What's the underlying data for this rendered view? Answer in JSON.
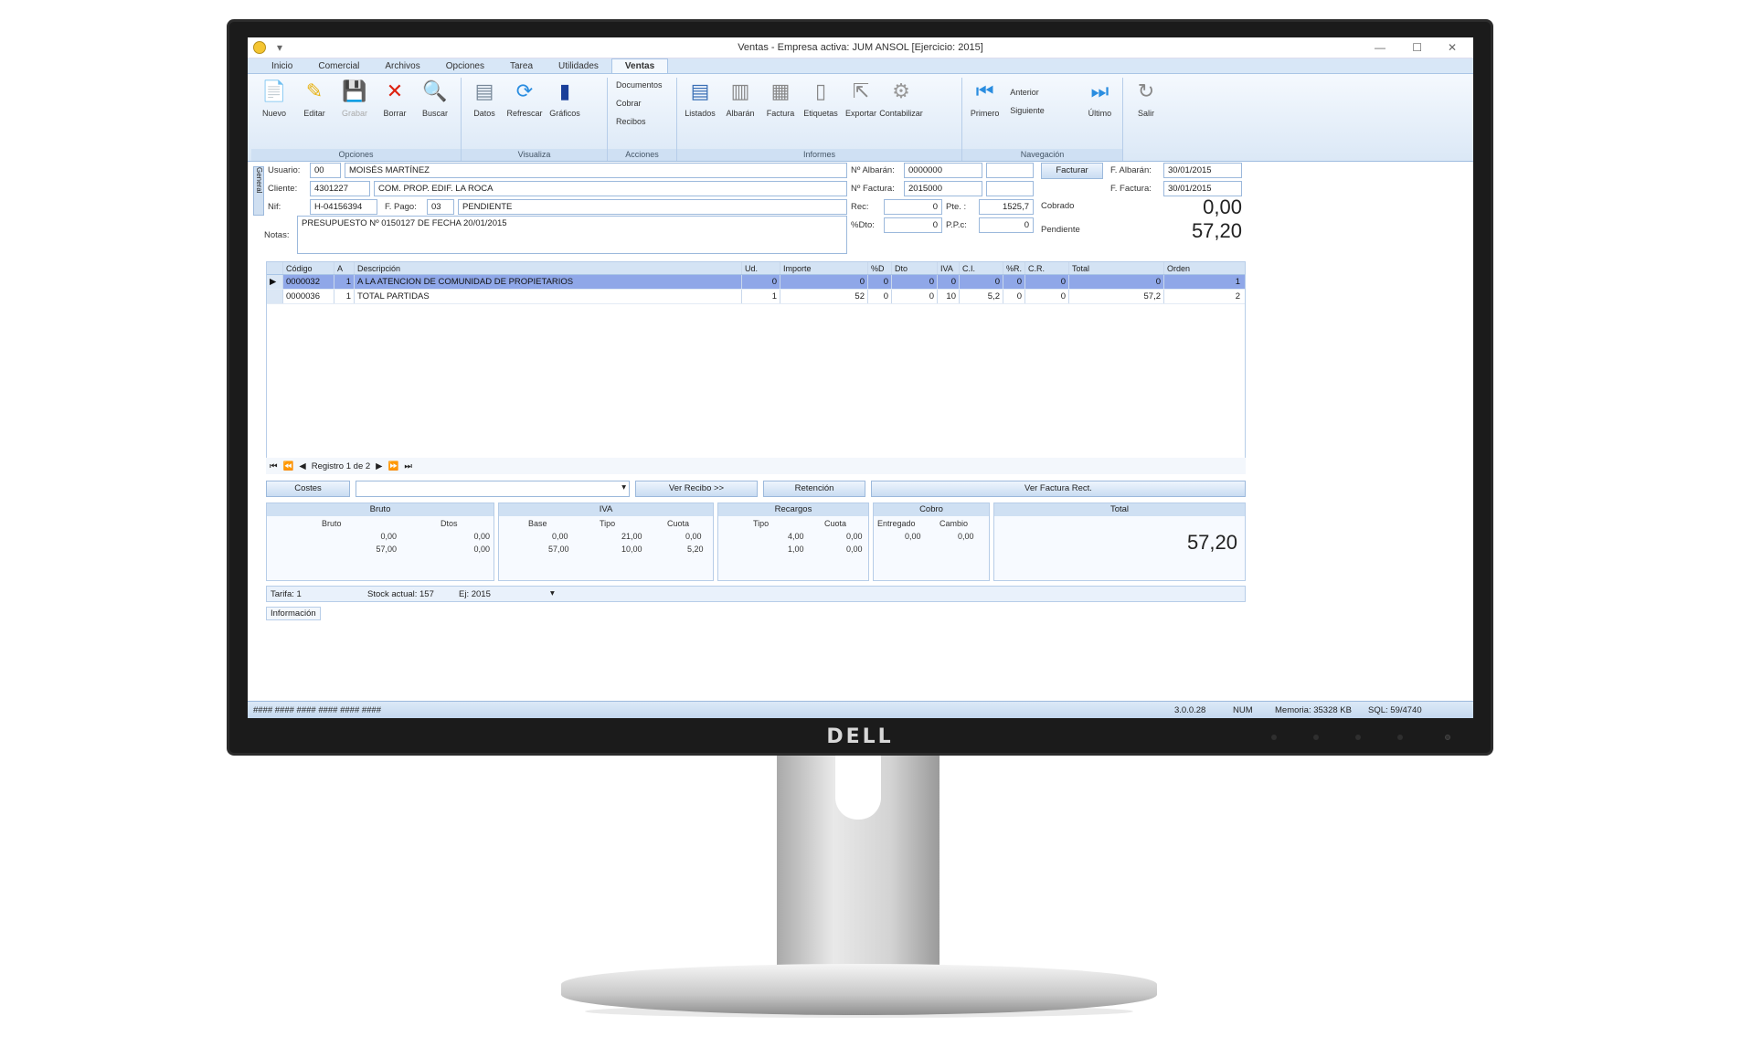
{
  "window": {
    "title": "Ventas - Empresa activa: JUM ANSOL [Ejercicio: 2015]"
  },
  "menu": {
    "tabs": [
      "Inicio",
      "Comercial",
      "Archivos",
      "Opciones",
      "Tarea",
      "Utilidades",
      "Ventas"
    ],
    "active": "Ventas"
  },
  "ribbon": {
    "opciones": {
      "label": "Opciones",
      "buttons": [
        "Nuevo",
        "Editar",
        "Grabar",
        "Borrar",
        "Buscar"
      ]
    },
    "visualiza": {
      "label": "Visualiza",
      "buttons": [
        "Datos",
        "Refrescar",
        "Gráficos"
      ]
    },
    "acciones": {
      "label": "Acciones",
      "buttons": [
        "Documentos",
        "Cobrar",
        "Recibos"
      ]
    },
    "informes": {
      "label": "Informes",
      "buttons": [
        "Listados",
        "Albarán",
        "Factura",
        "Etiquetas",
        "Exportar",
        "Contabilizar"
      ]
    },
    "navegacion": {
      "label": "Navegación",
      "buttons": [
        "Primero",
        "Anterior",
        "Siguiente",
        "Último"
      ]
    },
    "salir": {
      "label": "Salir"
    }
  },
  "form": {
    "side_tab": "General",
    "usuario_label": "Usuario:",
    "usuario_code": "00",
    "usuario_name": "MOISÉS MARTÍNEZ",
    "cliente_label": "Cliente:",
    "cliente_code": "4301227",
    "cliente_name": "COM. PROP. EDIF. LA ROCA",
    "nif_label": "Nif:",
    "nif_value": "H-04156394",
    "fpago_label": "F. Pago:",
    "fpago_code": "03",
    "fpago_name": "PENDIENTE",
    "notas_label": "Notas:",
    "notas_value": "PRESUPUESTO Nº 0150127 DE FECHA 20/01/2015",
    "nalbaran_label": "Nº Albarán:",
    "nalbaran_value": "0000000",
    "nfactura_label": "Nº Factura:",
    "nfactura_value": "2015000",
    "rec_label": "Rec:",
    "rec_value": "0",
    "pte_label": "Pte. :",
    "pte_value": "1525,7",
    "pcdto_label": "%Dto:",
    "pcdto_value": "0",
    "ppc_label": "P.P.c:",
    "ppc_value": "0",
    "factura_button": "Facturar",
    "falbaran_label": "F. Albarán:",
    "falbaran_value": "30/01/2015",
    "ffactura_label": "F. Factura:",
    "ffactura_value": "30/01/2015",
    "cobrado_label": "Cobrado",
    "cobrado_value": "0,00",
    "pendiente_label": "Pendiente",
    "pendiente_value": "57,20"
  },
  "grid": {
    "columns": [
      "Código",
      "A",
      "Descripción",
      "Ud.",
      "Importe",
      "%D",
      "Dto",
      "IVA",
      "C.I.",
      "%R.",
      "C.R.",
      "Total",
      "Orden"
    ],
    "rows": [
      [
        "0000032",
        "1",
        "A LA ATENCION DE COMUNIDAD DE PROPIETARIOS",
        "0",
        "0",
        "0",
        "0",
        "0",
        "0",
        "0",
        "0",
        "0",
        "1"
      ],
      [
        "0000036",
        "1",
        "TOTAL PARTIDAS",
        "1",
        "52",
        "0",
        "0",
        "10",
        "5,2",
        "0",
        "0",
        "57,2",
        "2"
      ]
    ]
  },
  "navbar": {
    "record": "Registro 1 de 2"
  },
  "actions": {
    "costes": "Costes",
    "ver_recibo": "Ver Recibo >>",
    "retencion": "Retención",
    "ver_factura": "Ver Factura Rect."
  },
  "totals": {
    "bruto": {
      "title": "Bruto",
      "col1": "Bruto",
      "col2": "Dtos",
      "r1": [
        "0,00",
        "0,00"
      ],
      "r2": [
        "57,00",
        "0,00"
      ]
    },
    "iva": {
      "title": "IVA",
      "col1": "Base",
      "col2": "Tipo",
      "col3": "Cuota",
      "r1": [
        "0,00",
        "21,00",
        "0,00"
      ],
      "r2": [
        "57,00",
        "10,00",
        "5,20"
      ]
    },
    "recargos": {
      "title": "Recargos",
      "col1": "Tipo",
      "col2": "Cuota",
      "r1": [
        "4,00",
        "0,00"
      ],
      "r2": [
        "1,00",
        "0,00"
      ]
    },
    "cobro": {
      "title": "Cobro",
      "col1": "Entregado",
      "col2": "Cambio",
      "r1": [
        "0,00",
        "0,00"
      ]
    },
    "total": {
      "title": "Total",
      "value": "57,20"
    }
  },
  "bottombar": {
    "tarifa": "Tarifa: 1",
    "stock": "Stock actual: 157",
    "ej": "Ej: 2015"
  },
  "info_tab": "Información",
  "status": {
    "left": "#### #### #### #### #### ####",
    "version": "3.0.0.28",
    "num": "NUM",
    "memoria": "Memoria: 35328 KB",
    "sql": "SQL: 59/4740"
  },
  "brand": "DELL"
}
